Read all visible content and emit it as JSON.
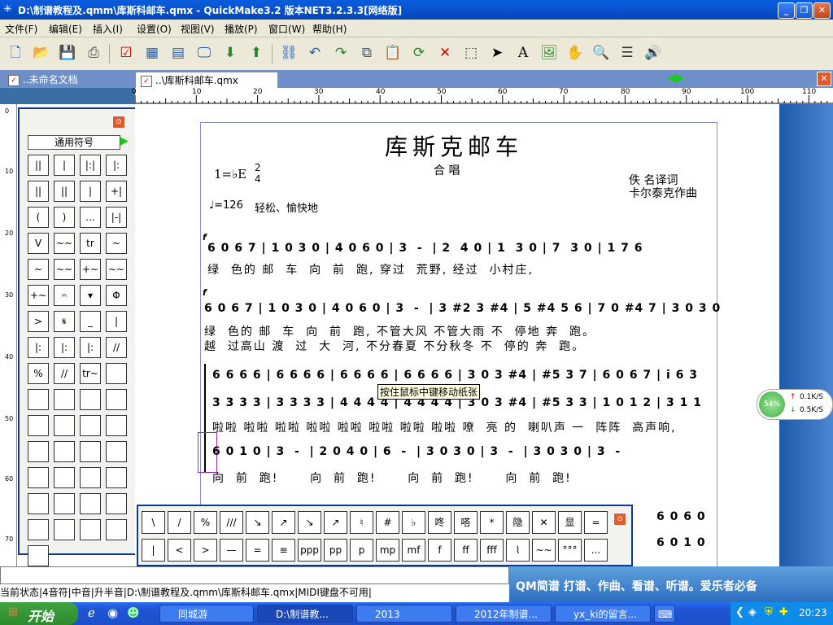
{
  "window": {
    "title": "D:\\制谱教程及.qmm\\库斯科邮车.qmx - QuickMake3.2 版本NET3.2.3.3[网络版]"
  },
  "menu": [
    "文件(F)",
    "编辑(E)",
    "插入(I)",
    "设置(O)",
    "视图(V)",
    "播放(P)",
    "窗口(W)",
    "帮助(H)"
  ],
  "tabs": [
    {
      "label": "..未命名文档"
    },
    {
      "label": "..\\库斯科邮车.qmx"
    }
  ],
  "ruler": {
    "labels": [
      "0",
      "10",
      "20",
      "30",
      "40",
      "50",
      "60",
      "70",
      "80",
      "90",
      "100",
      "110"
    ]
  },
  "vruler": {
    "labels": [
      "0",
      "10",
      "20",
      "30",
      "40",
      "50",
      "60",
      "70"
    ]
  },
  "palette": {
    "title": "通用符号",
    "cells": [
      "||",
      "|",
      "|:|",
      "|:",
      "||",
      "||",
      "|",
      "+|",
      "(",
      ")",
      "...",
      "|-|",
      "V",
      "~~",
      "tr",
      "~",
      "~",
      "~~",
      "+~",
      "~~",
      "+~",
      "𝄐",
      "▾",
      "Φ",
      ">",
      "𝄋",
      "_",
      "|",
      "|:",
      "|:",
      "|:",
      "//",
      "%",
      "//",
      "tr~",
      "",
      "",
      "",
      "",
      "",
      "",
      "",
      "",
      "",
      "",
      "",
      "",
      "",
      "",
      "",
      "",
      "",
      "",
      "",
      "",
      "",
      "",
      "",
      "",
      "",
      ""
    ]
  },
  "score": {
    "title": "库斯克邮车",
    "subtitle": "合 唱",
    "key": "1=♭E",
    "time_num": "2",
    "time_den": "4",
    "tempo": "♩=126",
    "tempo_text": "轻松、愉快地",
    "credit1": "佚    名译词",
    "credit2": "卡尔泰克作曲",
    "line1_notes": "6 0 6 7 | 1 0 3 0 | 4 0 6 0 | 3  -  | 2  4 0 | 1  3 0 | 7  3 0 | 1 7 6",
    "line1_lyrics": "绿  色的 邮  车  向  前  跑, 穿过  荒野, 经过  小村庄,",
    "line2_notes": "6 0 6 7 | 1 0 3 0 | 4 0 6 0 | 3  -  | 3 #2 3 #4 | 5 #4 5 6 | 7 0 #4 7 | 3 0 3 0",
    "line2_lyrics1": "绿  色的 邮  车  向  前  跑, 不管大风 不管大雨 不  停地 奔  跑。",
    "line2_lyrics2": "越  过高山 渡  过  大  河, 不分春夏 不分秋冬 不  停的 奔  跑。",
    "line3_notes_a": "6 6 6 6 | 6 6 6 6 | 6 6 6 6 | 6 6 6 6 | 3 0 3 #4 | #5 3 7 | 6 0 6 7 | i 6 3",
    "line3_notes_b": "3 3 3 3 | 3 3 3 3 | 4 4 4 4 | 4 4 4 4 | 3 0 3 #4 | #5 3 3 | 1 0 1 2 | 3 1 1",
    "line3_lyrics": "啦啦 啦啦 啦啦 啦啦 啦啦 啦啦 啦啦 啦啦 嘹  亮 的  喇叭声 一  阵阵  高声响,",
    "line4_notes": "6 0 1 0 | 3  -  | 2 0 4 0 | 6  -  | 3 0 3 0 | 3  -  | 3 0 3 0 | 3  -",
    "line4_lyrics": "向  前  跑!      向  前  跑!      向  前  跑!      向  前  跑!",
    "line5_notes_a": "6 0 6 0",
    "line5_notes_b": "6 0 1 0"
  },
  "tooltip": "按住鼠标中键移动纸张",
  "bottom_palette": {
    "row1": [
      "\\",
      "/",
      "%",
      "///",
      "↘",
      "↗",
      "↘",
      "↗",
      "♮",
      "#",
      "♭",
      "咚",
      "嗒",
      "*",
      "隐",
      "✕",
      "显",
      "="
    ],
    "row2": [
      "|",
      "<",
      ">",
      "—",
      "=",
      "≡",
      "ppp",
      "pp",
      "p",
      "mp",
      "mf",
      "f",
      "ff",
      "fff",
      "⌇",
      "~~",
      "°°°",
      "..."
    ]
  },
  "status": {
    "text": "当前状态|4音符|中音|升半音|D:\\制谱教程及.qmm\\库斯科邮车.qmx|MIDI键盘不可用|"
  },
  "banner": {
    "text": "QM简谱 打谱、作曲、看谱、听谱。爱乐者必备"
  },
  "netmeter": {
    "percent": "54%",
    "up": "0.1K/S",
    "down": "0.5K/S"
  },
  "taskbar": {
    "start": "开始",
    "tasks": [
      "同城游",
      "D:\\制谱教...",
      "2013",
      "2012年制谱...",
      "yx_ki的留言..."
    ],
    "clock": "20:23"
  }
}
